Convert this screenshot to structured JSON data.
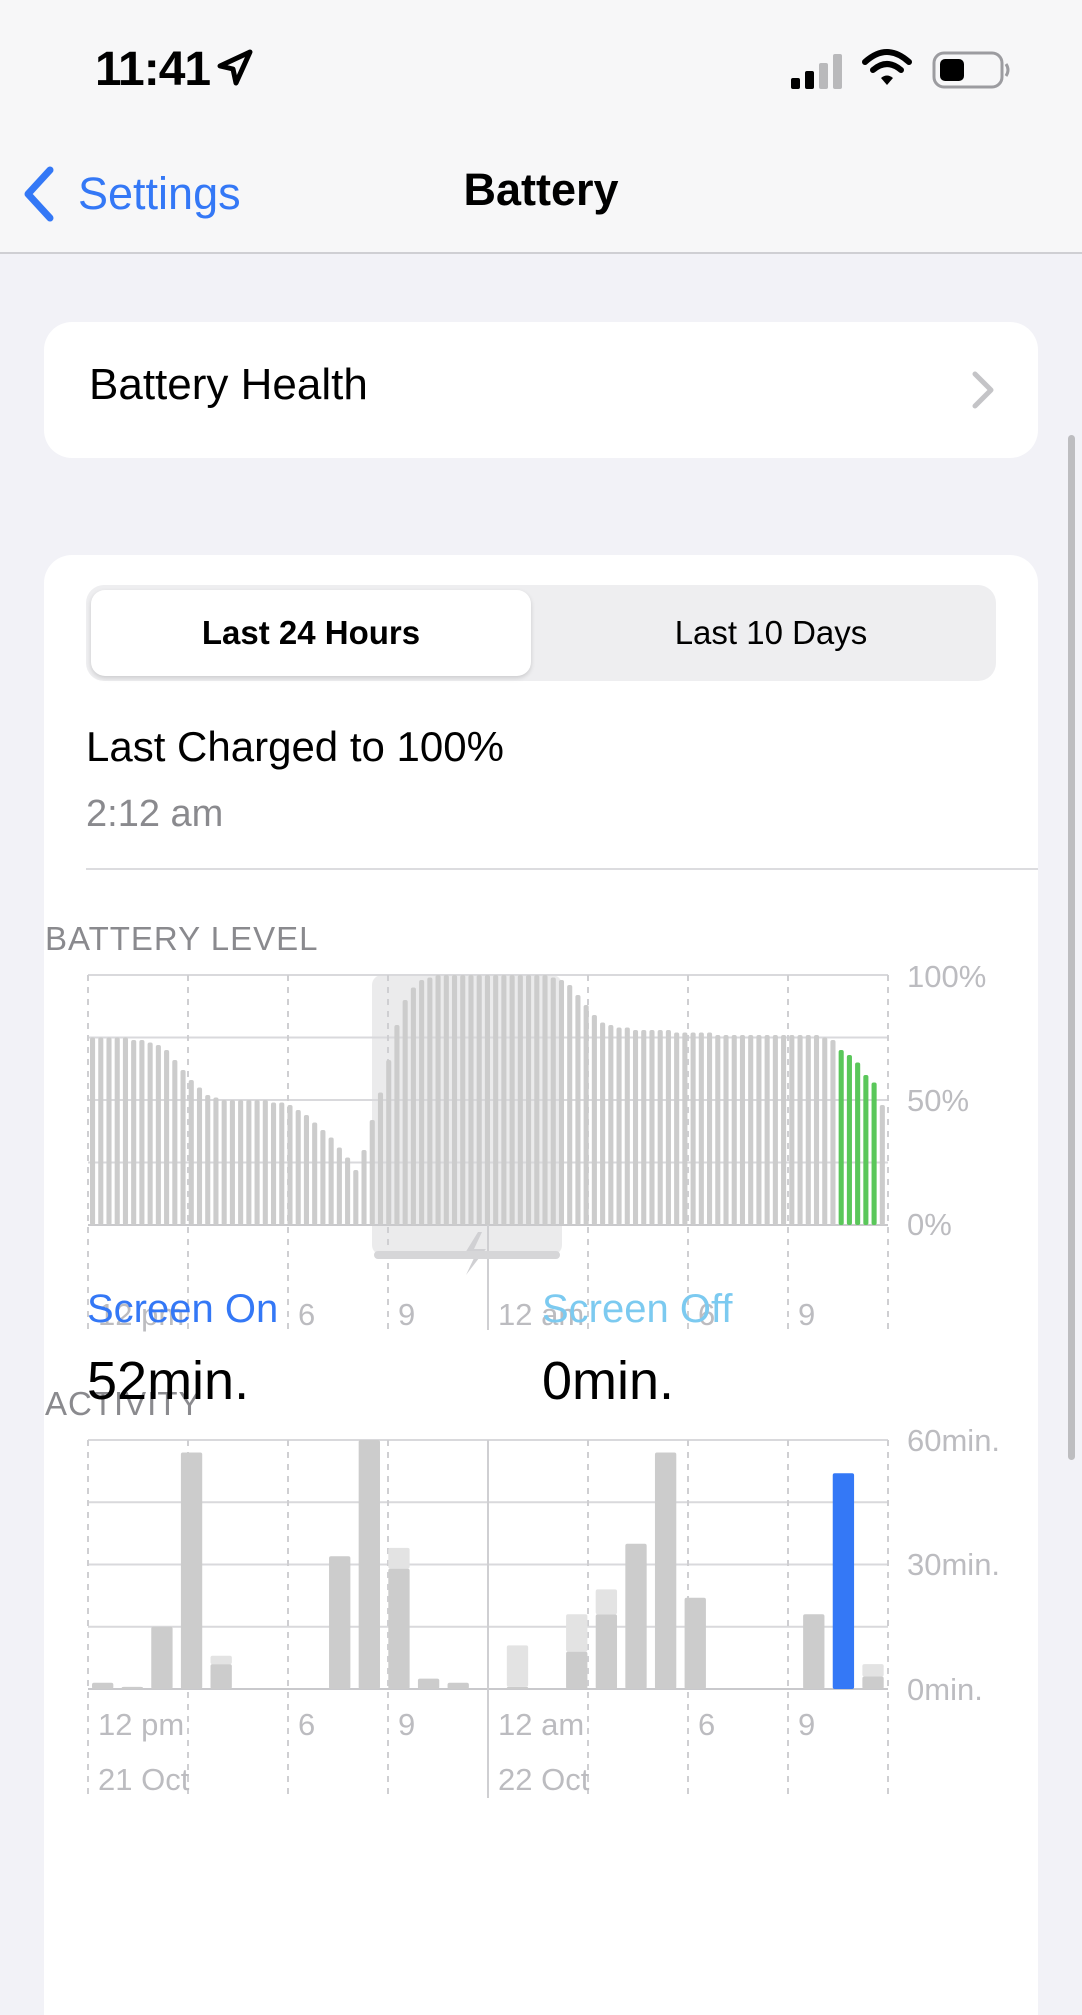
{
  "status_bar": {
    "time": "11:41"
  },
  "nav": {
    "back_label": "Settings",
    "title": "Battery"
  },
  "battery_health": {
    "label": "Battery Health"
  },
  "segments": {
    "active": "Last 24 Hours",
    "inactive": "Last 10 Days"
  },
  "last_charged": {
    "title": "Last Charged to 100%",
    "time": "2:12 am"
  },
  "labels": {
    "battery_level": "BATTERY LEVEL",
    "activity": "ACTIVITY"
  },
  "colors": {
    "accent": "#3478f6",
    "green": "#5ac75a",
    "gray_bar": "#cccccc",
    "light_bar": "#e3e3e3",
    "screen_off": "#7ccaf0"
  },
  "icons": [
    "location-arrow-icon",
    "cellular-signal-icon",
    "wifi-icon",
    "battery-icon",
    "chevron-left-icon",
    "chevron-right-icon",
    "charging-bolt-icon"
  ],
  "chart_data": [
    {
      "type": "bar",
      "title": "BATTERY LEVEL",
      "ylim": [
        0,
        100
      ],
      "y_ticks": [
        "100%",
        "50%",
        "0%"
      ],
      "x_ticks": [
        "12 pm",
        "6",
        "9",
        "12 am",
        "6",
        "9"
      ],
      "charging_indicator": true,
      "values": [
        75,
        75,
        75,
        75,
        75,
        74,
        74,
        73,
        72,
        70,
        66,
        62,
        58,
        55,
        52,
        51,
        50,
        50,
        50,
        50,
        50,
        50,
        49,
        49,
        48,
        46,
        44,
        41,
        38,
        35,
        31,
        27,
        22,
        30,
        42,
        53,
        66,
        80,
        90,
        95,
        98,
        99,
        100,
        100,
        100,
        100,
        100,
        100,
        100,
        100,
        100,
        100,
        100,
        100,
        100,
        100,
        99,
        98,
        96,
        92,
        88,
        84,
        81,
        80,
        79,
        79,
        78,
        78,
        78,
        78,
        78,
        77,
        77,
        77,
        77,
        77,
        76,
        76,
        76,
        76,
        76,
        76,
        76,
        76,
        76,
        76,
        76,
        76,
        76,
        75,
        74,
        70,
        68,
        65,
        60,
        57,
        48
      ],
      "current_series_start_index": 91
    },
    {
      "type": "bar",
      "title": "ACTIVITY",
      "ylim": [
        0,
        60
      ],
      "y_ticks": [
        "60min.",
        "30min.",
        "0min."
      ],
      "x_ticks": [
        "12 pm",
        "6",
        "9",
        "12 am",
        "6",
        "9"
      ],
      "date_labels": [
        "21 Oct",
        "22 Oct"
      ],
      "series": [
        {
          "name": "Screen On",
          "values": [
            1.5,
            0.5,
            15,
            57,
            6,
            0,
            0,
            0,
            32,
            60,
            29,
            2.5,
            1.5,
            0,
            0.5,
            0,
            9,
            18,
            35,
            57,
            22,
            0,
            0,
            0,
            18,
            52,
            3
          ]
        },
        {
          "name": "Screen Off",
          "values": [
            0,
            0,
            0,
            0,
            2,
            0,
            0,
            0,
            0,
            0,
            5,
            0,
            0,
            0,
            10,
            0,
            9,
            6,
            0,
            0,
            0,
            0,
            0,
            0,
            0,
            0,
            3
          ]
        }
      ],
      "highlight_index": 25
    }
  ],
  "legend": {
    "screen_on_label": "Screen On",
    "screen_on_value": "52min.",
    "screen_off_label": "Screen Off",
    "screen_off_value": "0min."
  }
}
